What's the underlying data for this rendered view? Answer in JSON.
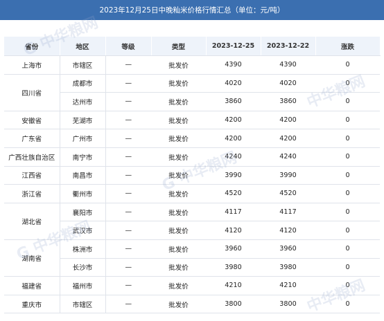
{
  "title": "2023年12月25日中晚籼米价格行情汇总（单位：元/吨）",
  "watermark_text": "中华粮网",
  "columns": [
    "省份",
    "地区",
    "等级",
    "类型",
    "2023-12-25",
    "2023-12-22",
    "涨跌"
  ],
  "rows": [
    {
      "province": "上海市",
      "district": "市辖区",
      "grade": "—",
      "type": "批发价",
      "p1": "4390",
      "p2": "4390",
      "chg": "0"
    },
    {
      "province": "四川省",
      "district": "成都市",
      "grade": "—",
      "type": "批发价",
      "p1": "4020",
      "p2": "4020",
      "chg": "0"
    },
    {
      "province": "",
      "district": "达州市",
      "grade": "—",
      "type": "批发价",
      "p1": "3860",
      "p2": "3860",
      "chg": "0"
    },
    {
      "province": "安徽省",
      "district": "芜湖市",
      "grade": "—",
      "type": "批发价",
      "p1": "4200",
      "p2": "4200",
      "chg": "0"
    },
    {
      "province": "广东省",
      "district": "广州市",
      "grade": "—",
      "type": "批发价",
      "p1": "4200",
      "p2": "4200",
      "chg": "0"
    },
    {
      "province": "广西壮族自治区",
      "district": "南宁市",
      "grade": "—",
      "type": "批发价",
      "p1": "4240",
      "p2": "4240",
      "chg": "0"
    },
    {
      "province": "江西省",
      "district": "南昌市",
      "grade": "—",
      "type": "批发价",
      "p1": "3990",
      "p2": "3990",
      "chg": "0"
    },
    {
      "province": "浙江省",
      "district": "衢州市",
      "grade": "—",
      "type": "批发价",
      "p1": "4520",
      "p2": "4520",
      "chg": "0"
    },
    {
      "province": "湖北省",
      "district": "襄阳市",
      "grade": "—",
      "type": "批发价",
      "p1": "4117",
      "p2": "4117",
      "chg": "0"
    },
    {
      "province": "",
      "district": "武汉市",
      "grade": "—",
      "type": "批发价",
      "p1": "4120",
      "p2": "4120",
      "chg": "0"
    },
    {
      "province": "湖南省",
      "district": "株洲市",
      "grade": "—",
      "type": "批发价",
      "p1": "3960",
      "p2": "3960",
      "chg": "0"
    },
    {
      "province": "",
      "district": "长沙市",
      "grade": "—",
      "type": "批发价",
      "p1": "3980",
      "p2": "3980",
      "chg": "0"
    },
    {
      "province": "福建省",
      "district": "福州市",
      "grade": "—",
      "type": "批发价",
      "p1": "4210",
      "p2": "4210",
      "chg": "0"
    },
    {
      "province": "重庆市",
      "district": "市辖区",
      "grade": "—",
      "type": "批发价",
      "p1": "3800",
      "p2": "3800",
      "chg": "0"
    }
  ],
  "colors": {
    "title_bar": "#3b6fb0",
    "header_bg": "#eef3fa",
    "border": "#dfe3ea"
  }
}
